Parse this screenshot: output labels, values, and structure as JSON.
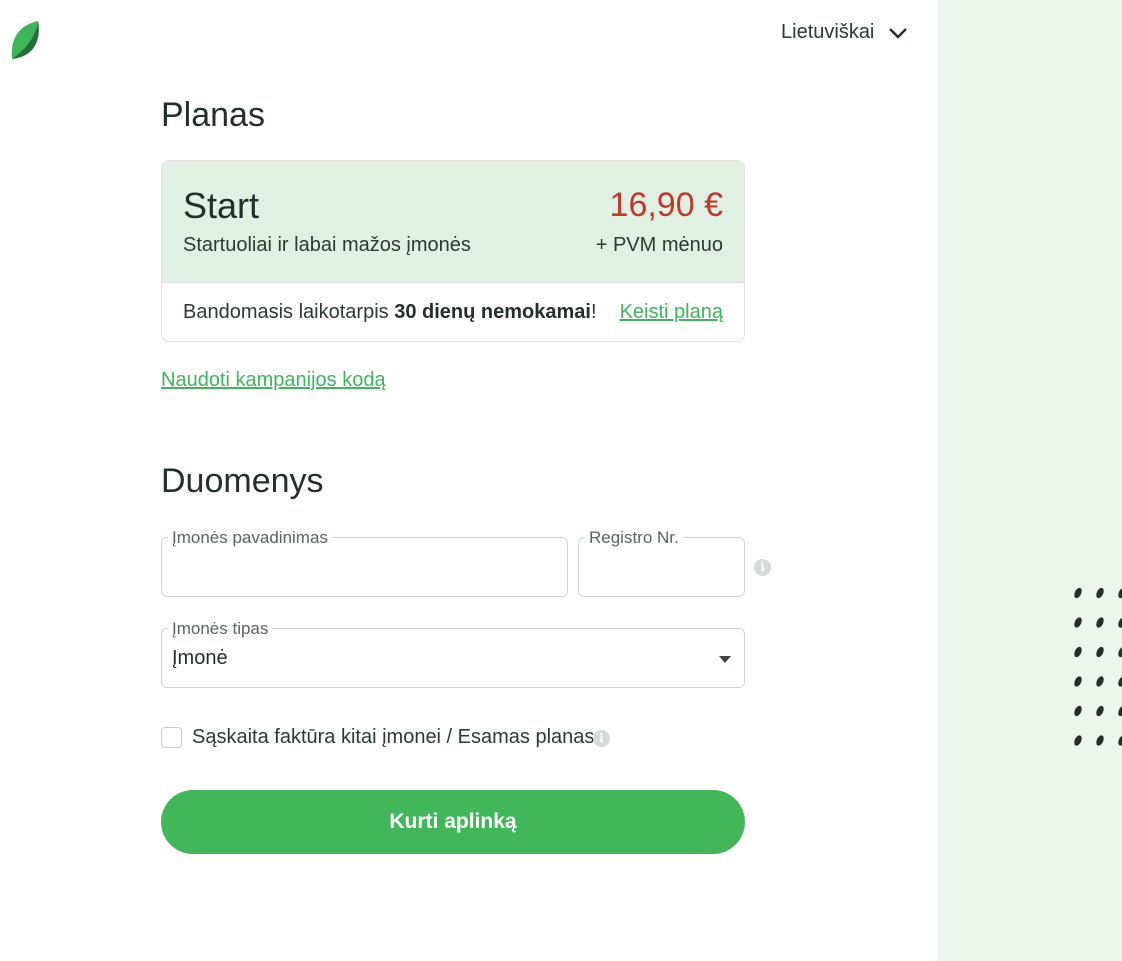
{
  "header": {
    "logo_icon": "leaf-logo-icon",
    "language": {
      "label": "Lietuviškai",
      "icon": "chevron-down-icon"
    }
  },
  "colors": {
    "accent": "#42b75a",
    "link": "#3fb55a",
    "price": "#c0392b",
    "plan_head_bg": "#e0f1e4",
    "side_panel_bg": "#ecf6ed"
  },
  "plan_section": {
    "title": "Planas",
    "plan": {
      "name": "Start",
      "description": "Startuoliai ir labai mažos įmonės",
      "price": "16,90 €",
      "price_unit": "+ PVM mėnuo"
    },
    "trial": {
      "prefix": "Bandomasis laikotarpis ",
      "highlight": "30 dienų nemokamai",
      "suffix": "!"
    },
    "change_plan_label": "Keisti planą",
    "campaign_link_label": "Naudoti kampanijos kodą"
  },
  "data_section": {
    "title": "Duomenys",
    "company_name": {
      "label": "Įmonės pavadinimas",
      "value": ""
    },
    "registry_no": {
      "label": "Registro Nr.",
      "value": "",
      "info_icon": "info-icon"
    },
    "company_type": {
      "label": "Įmonės tipas",
      "value": "Įmonė"
    },
    "invoice_checkbox": {
      "label": "Sąskaita faktūra kitai įmonei / Esamas planas",
      "checked": false,
      "info_icon": "info-icon"
    },
    "submit_label": "Kurti aplinką"
  }
}
